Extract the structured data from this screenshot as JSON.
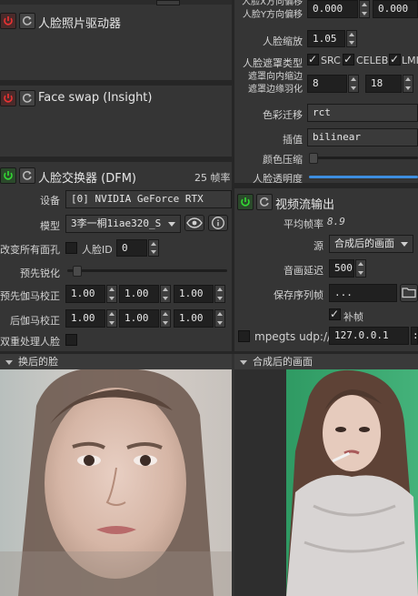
{
  "left": {
    "photo_driver": {
      "title": "人脸照片驱动器"
    },
    "face_swap": {
      "title": "Face swap (Insight)"
    },
    "dfm": {
      "title": "人脸交换器 (DFM)",
      "fps": "25 帧率",
      "device_label": "设备",
      "device_value": "[0] NVIDIA GeForce RTX",
      "model_label": "模型",
      "model_value": "3李一桐1iae320_S",
      "swap_all_label": "改变所有面孔",
      "face_id_label": "人脸ID",
      "face_id_value": "0",
      "presharpen_label": "预先锐化",
      "presharpen_value": 0.05,
      "pre_gamma_label": "预先伽马校正",
      "pre_gamma_values": [
        "1.00",
        "1.00",
        "1.00"
      ],
      "post_gamma_label": "后伽马校正",
      "post_gamma_values": [
        "1.00",
        "1.00",
        "1.00"
      ],
      "two_pass_label": "双重处理人脸"
    },
    "swapped_face_header": "换后的脸"
  },
  "right": {
    "offset_x_label": "人脸X方向偏移",
    "offset_y_label": "人脸Y方向偏移",
    "offset_x_value": "0.000",
    "offset_y_value": "0.000",
    "scale_label": "人脸缩放",
    "scale_value": "1.05",
    "mask_type_label": "人脸遮罩类型",
    "mask_types": [
      "SRC",
      "CELEB",
      "LMI"
    ],
    "mask_erode_label": "遮罩向内缩边",
    "mask_blur_label": "遮罩边缘羽化",
    "mask_erode_value": "8",
    "mask_blur_value": "18",
    "color_transfer_label": "色彩迁移",
    "color_transfer_value": "rct",
    "interp_label": "插值",
    "interp_value": "bilinear",
    "color_compress_label": "颜色压缩",
    "color_compress_value": 0.0,
    "opacity_label": "人脸透明度",
    "opacity_value": 1.0,
    "stream": {
      "title": "视频流输出",
      "avg_fps_label": "平均帧率",
      "avg_fps_value": "8.9",
      "source_label": "源",
      "source_value": "合成后的画面",
      "audio_delay_label": "音画延迟",
      "audio_delay_value": "500",
      "save_seq_label": "保存序列帧",
      "save_seq_value": "...",
      "fill_frames_label": "补帧",
      "mpegts_label": "mpegts udp://",
      "mpegts_value": "127.0.0.1"
    },
    "merged_header": "合成后的画面"
  }
}
